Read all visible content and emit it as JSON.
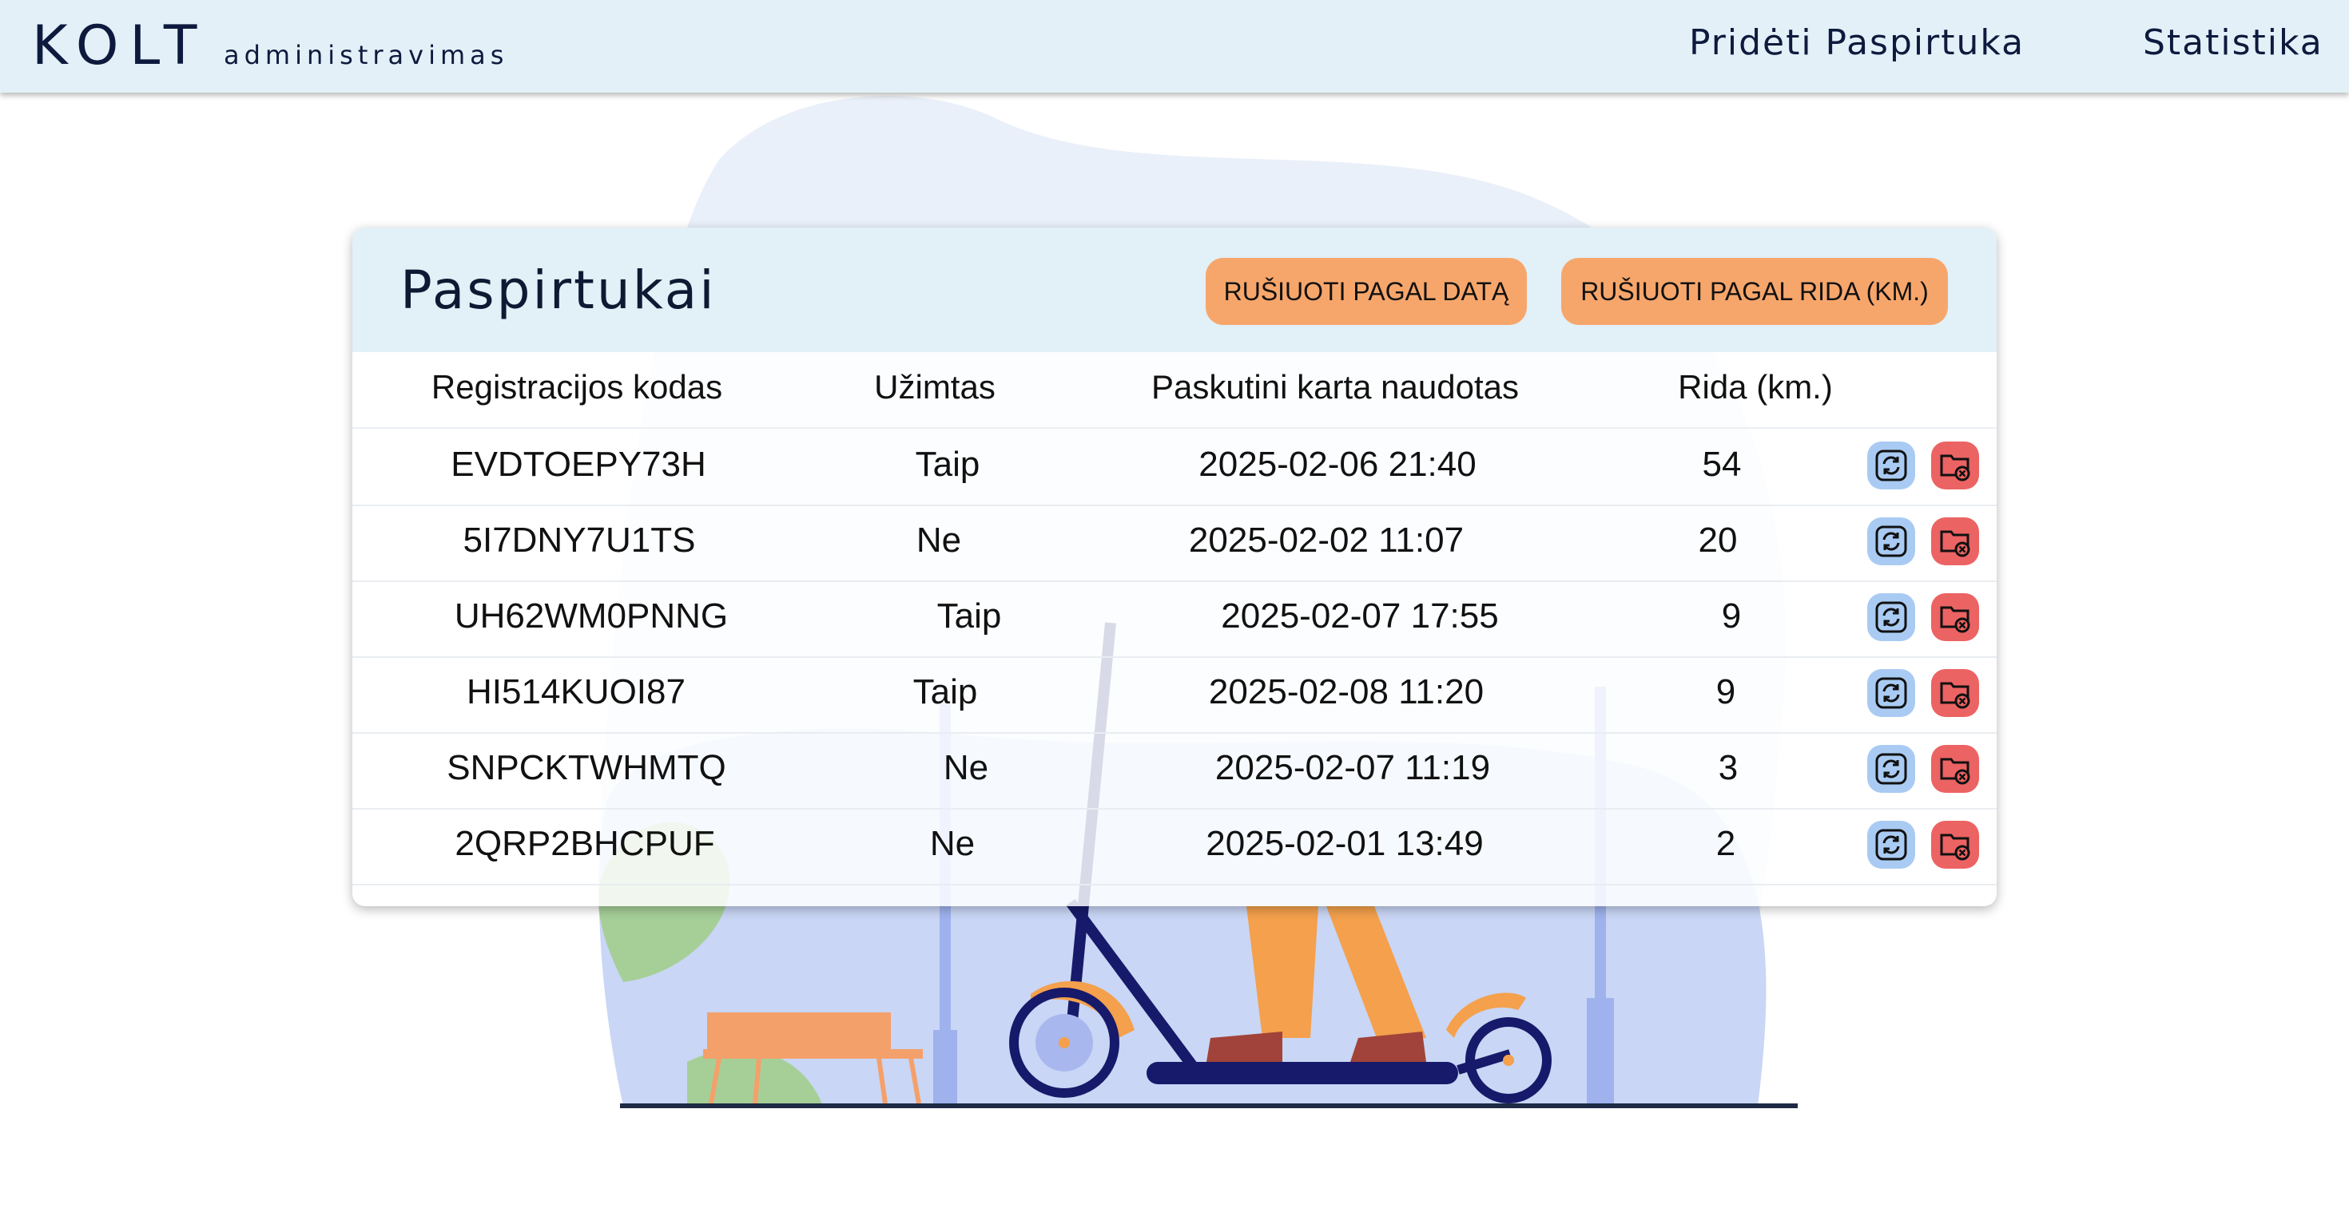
{
  "header": {
    "logo": "KOLT",
    "logo_sub": "administravimas",
    "nav": [
      "Pridėti Paspirtuka",
      "Statistika"
    ]
  },
  "card": {
    "title": "Paspirtukai",
    "sort_date_label": "RUŠIUOTI PAGAL DATĄ",
    "sort_mileage_label": "RUŠIUOTI PAGAL RIDA (KM.)"
  },
  "table": {
    "columns": [
      "Registracijos kodas",
      "Užimtas",
      "Paskutini karta naudotas",
      "Rida (km.)"
    ],
    "rows": [
      {
        "code": "EVDTOEPY73H",
        "busy": "Taip",
        "last_used": "2025-02-06 21:40",
        "mileage": "54"
      },
      {
        "code": "5I7DNY7U1TS",
        "busy": "Ne",
        "last_used": "2025-02-02 11:07",
        "mileage": "20"
      },
      {
        "code": "UH62WM0PNNG",
        "busy": "Taip",
        "last_used": "2025-02-07 17:55",
        "mileage": "9"
      },
      {
        "code": "HI514KUOI87",
        "busy": "Taip",
        "last_used": "2025-02-08 11:20",
        "mileage": "9"
      },
      {
        "code": "SNPCKTWHMTQ",
        "busy": "Ne",
        "last_used": "2025-02-07 11:19",
        "mileage": "3"
      },
      {
        "code": "2QRP2BHCPUF",
        "busy": "Ne",
        "last_used": "2025-02-01 13:49",
        "mileage": "2"
      }
    ]
  },
  "colors": {
    "header_bg": "#e3f0f8",
    "button_orange": "#f7a66b",
    "refresh_blue": "#a9cbf3",
    "delete_red": "#ec6363"
  },
  "icons": {
    "row_refresh": "refresh-icon",
    "row_delete": "delete-folder-icon"
  }
}
